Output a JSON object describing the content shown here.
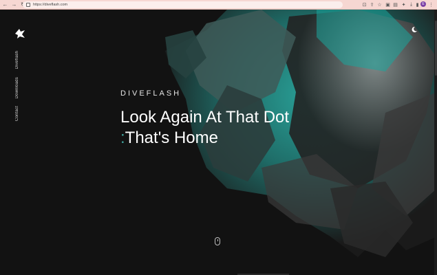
{
  "browser": {
    "url": "https://diveflash.com"
  },
  "site": {
    "brand_eyebrow": "DIVEFLASH",
    "headline_line1": "Look Again At That Dot",
    "headline_accent": ":",
    "headline_line2": "That's Home",
    "nav": [
      {
        "label": "Diveflash"
      },
      {
        "label": "Downloads"
      },
      {
        "label": "Contact"
      }
    ],
    "icons": {
      "logo": "diveflash-logo-icon",
      "theme": "moon-icon",
      "scroll": "mouse-scroll-icon"
    }
  },
  "colors": {
    "accent": "#40a7a0",
    "background": "#121212",
    "chrome": "#f6d7d2"
  }
}
